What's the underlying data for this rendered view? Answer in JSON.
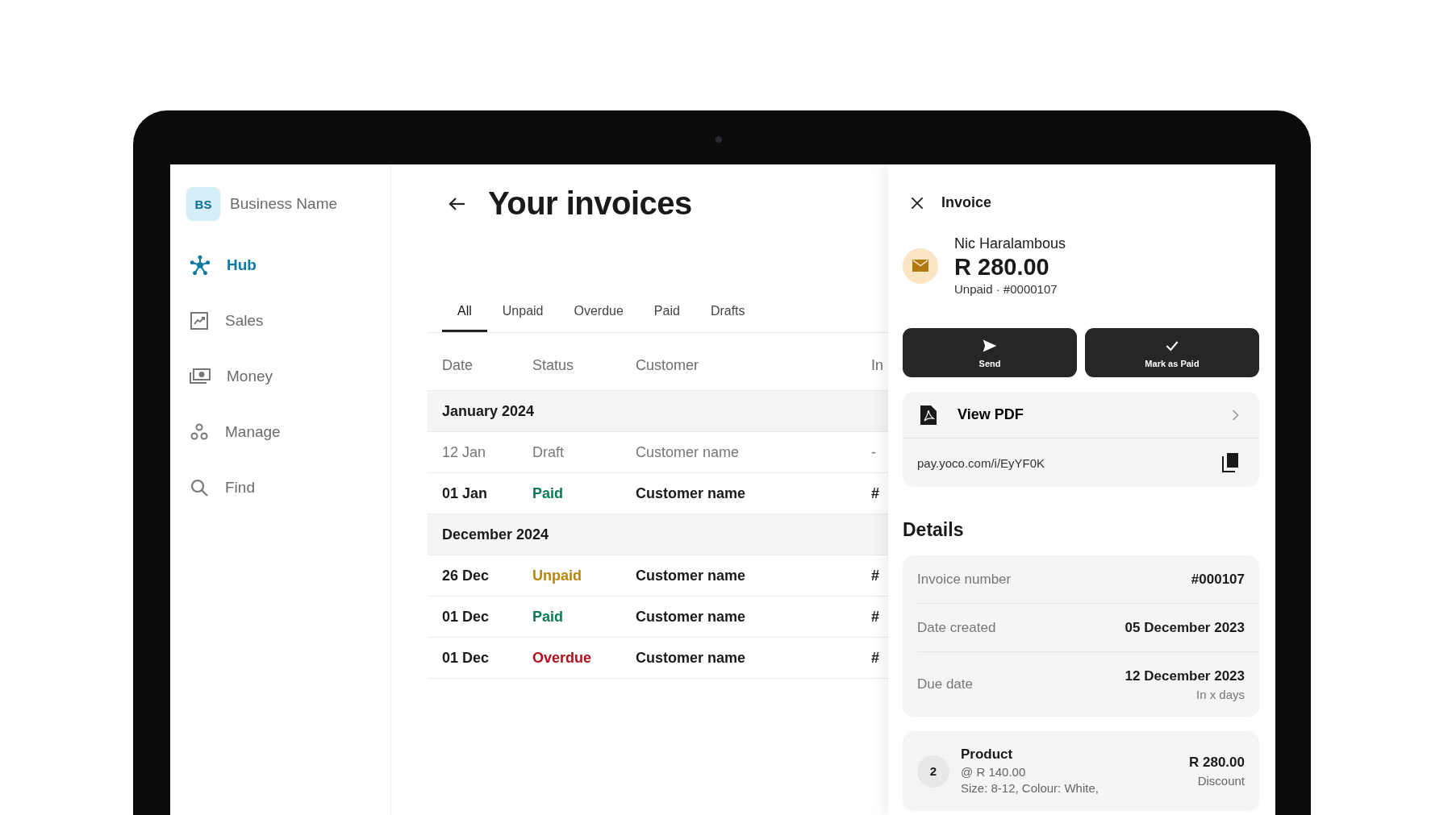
{
  "sidebar": {
    "business": {
      "initials": "BS",
      "name": "Business Name"
    },
    "items": [
      {
        "label": "Hub",
        "selected": true
      },
      {
        "label": "Sales",
        "selected": false
      },
      {
        "label": "Money",
        "selected": false
      },
      {
        "label": "Manage",
        "selected": false
      },
      {
        "label": "Find",
        "selected": false
      }
    ]
  },
  "main": {
    "title": "Your invoices",
    "tabs": [
      {
        "label": "All",
        "selected": true
      },
      {
        "label": "Unpaid",
        "selected": false
      },
      {
        "label": "Overdue",
        "selected": false
      },
      {
        "label": "Paid",
        "selected": false
      },
      {
        "label": "Drafts",
        "selected": false
      }
    ],
    "table": {
      "columns": [
        "Date",
        "Status",
        "Customer",
        "In"
      ],
      "rows": [
        {
          "kind": "group",
          "label": "January 2024"
        },
        {
          "kind": "draft",
          "date": "12 Jan",
          "status": "Draft",
          "color": "#7a7a7a",
          "customer": "Customer name",
          "column_4": "-"
        },
        {
          "kind": "invoice",
          "date": "01 Jan",
          "status": "Paid",
          "color": "#0a7a55",
          "customer": "Customer name",
          "column_4": "#"
        },
        {
          "kind": "group",
          "label": "December 2024"
        },
        {
          "kind": "invoice",
          "date": "26 Dec",
          "status": "Unpaid",
          "color": "#b8860b",
          "customer": "Customer name",
          "column_4": "#"
        },
        {
          "kind": "invoice",
          "date": "01 Dec",
          "status": "Paid",
          "color": "#0a7a55",
          "customer": "Customer name",
          "column_4": "#"
        },
        {
          "kind": "invoice",
          "date": "01 Dec",
          "status": "Overdue",
          "color": "#b0101e",
          "customer": "Customer name",
          "column_4": "#"
        }
      ]
    }
  },
  "drawer": {
    "title": "Invoice",
    "customer": "Nic Haralambous",
    "amount": "R 280.00",
    "status": "Unpaid · #0000107",
    "buttons": [
      {
        "label": "Send"
      },
      {
        "label": "Mark as Paid"
      }
    ],
    "pdf": {
      "label": "View PDF",
      "link": "pay.yoco.com/i/EyYF0K"
    },
    "details_title": "Details",
    "details": [
      {
        "label": "Invoice number",
        "value": "#000107"
      },
      {
        "label": "Date created",
        "value": "05 December 2023"
      },
      {
        "label": "Due date",
        "value": "12 December 2023",
        "note": "In x days"
      }
    ],
    "product": {
      "quantity": "2",
      "name": "Product",
      "unit_price": "@ R 140.00",
      "options": "Size: 8-12, Colour: White,",
      "total": "R 280.00",
      "discount": "Discount"
    }
  }
}
